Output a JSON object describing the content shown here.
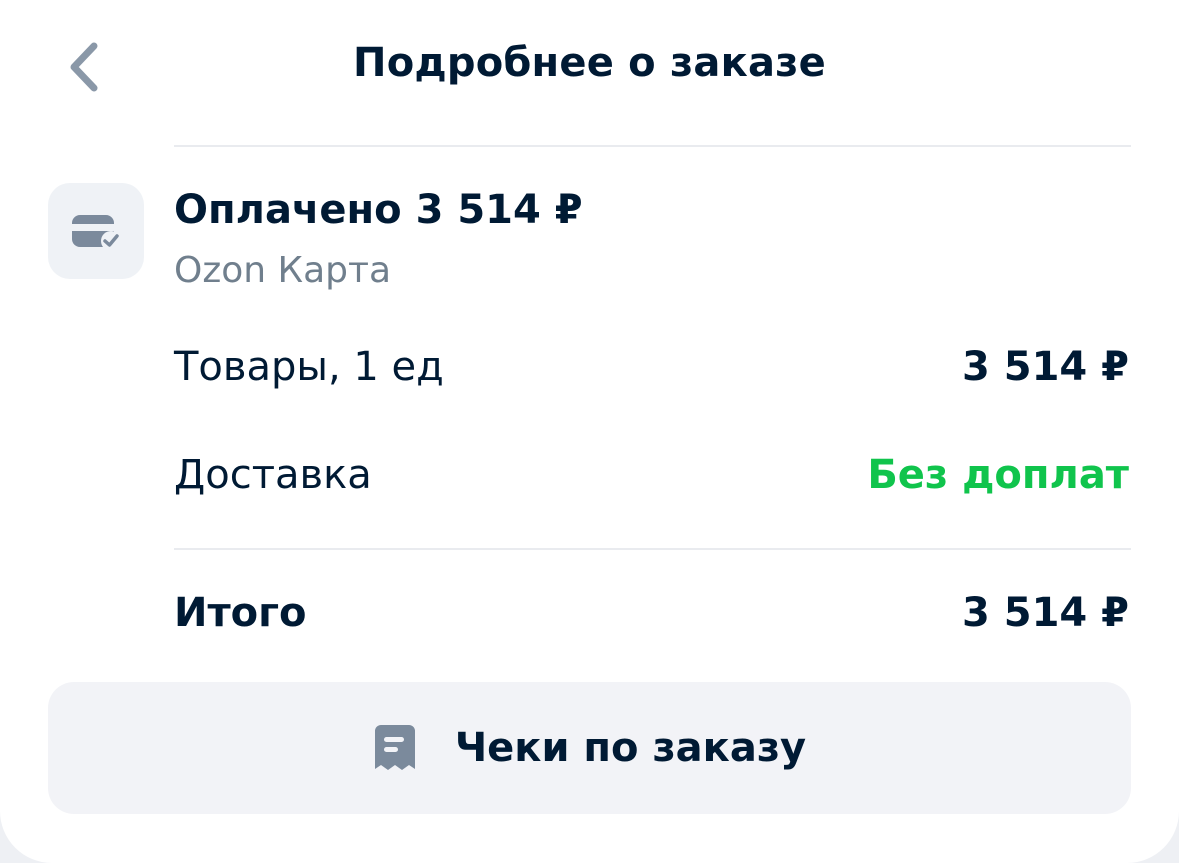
{
  "header": {
    "title": "Подробнее о заказе",
    "back_icon": "chevron-left-icon"
  },
  "payment": {
    "icon": "card-check-icon",
    "title": "Оплачено 3 514 ₽",
    "method": "Ozon Карта"
  },
  "items": [
    {
      "label": "Товары, 1 ед",
      "value": "3 514 ₽"
    },
    {
      "label": "Доставка",
      "value": "Без доплат"
    }
  ],
  "total": {
    "label": "Итого",
    "value": "3 514 ₽"
  },
  "receipts_button": {
    "label": "Чеки по заказу",
    "icon": "receipt-icon"
  },
  "colors": {
    "text": "#001a34",
    "muted": "#707f8d",
    "accent_green": "#10c44c",
    "surface": "#f2f3f7"
  }
}
